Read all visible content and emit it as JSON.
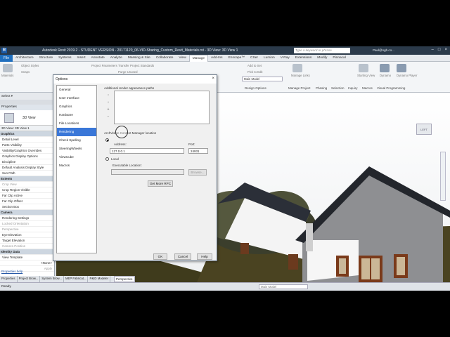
{
  "titlebar": {
    "app_title": "Autodesk Revit 2019.2 - STUDENT VERSION -   20171120_06-VID-Sharing_Custom_Revit_Materials.rvt - 3D View: 3D View 1",
    "search_placeholder": "Type a keyword or phrase",
    "user": "Paul@ngb.co..."
  },
  "tabs": [
    "File",
    "Architecture",
    "Structure",
    "Systems",
    "Insert",
    "Annotate",
    "Analyze",
    "Massing & Site",
    "Collaborate",
    "View",
    "Manage",
    "Add-Ins",
    "Enscape™",
    "CSer",
    "Lumion",
    "V-Ray",
    "Extensions",
    "Modify",
    "Pinnacal"
  ],
  "active_tab": "Manage",
  "ribbon": {
    "items": [
      "Materials",
      "Object Styles",
      "Snaps",
      "Project Parameters",
      "Transfer Project Standards",
      "Purge Unused",
      "Add to Set",
      "Pick to Edit",
      "Main Model",
      "Manage Links",
      "Starting View",
      "Dynamo",
      "Dynamo Player"
    ],
    "panels": [
      "Design Options",
      "Manage Project",
      "Phasing",
      "Selection",
      "Inquiry",
      "Macros",
      "Visual Programming"
    ]
  },
  "select_label": "Select ▾",
  "properties": {
    "header": "Properties",
    "type_name": "3D View",
    "selection": "3D View: 3D View 1",
    "rows": [
      {
        "label": "Graphics",
        "group": true
      },
      {
        "label": "Detail Level"
      },
      {
        "label": "Parts Visibility"
      },
      {
        "label": "Visibility/Graphics Overrides"
      },
      {
        "label": "Graphics Display Options"
      },
      {
        "label": "Discipline"
      },
      {
        "label": "Default Analysis Display Style"
      },
      {
        "label": "Sun Path"
      },
      {
        "label": "Extents",
        "group": true
      },
      {
        "label": "Crop View",
        "dim": true
      },
      {
        "label": "Crop Region Visible"
      },
      {
        "label": "Far Clip Active"
      },
      {
        "label": "Far Clip Offset"
      },
      {
        "label": "Section Box"
      },
      {
        "label": "Camera",
        "group": true
      },
      {
        "label": "Rendering Settings"
      },
      {
        "label": "Locked Orientation",
        "dim": true
      },
      {
        "label": "Perspective",
        "dim": true
      },
      {
        "label": "Eye Elevation"
      },
      {
        "label": "Target Elevation"
      },
      {
        "label": "Camera Position",
        "dim": true
      },
      {
        "label": "Identity Data",
        "group": true
      },
      {
        "label": "View Template"
      }
    ],
    "view_template_value": "<None>",
    "help_link": "Properties help",
    "apply": "Apply"
  },
  "bottom_tabs": [
    "Properties",
    "Project Brow...",
    "System Brow...",
    "MEP Fabricat...",
    "P&ID Modeler"
  ],
  "view_tab": "Perspective",
  "status": {
    "ready": "Ready",
    "main_model": "Main Model"
  },
  "viewport": {
    "viewcube_label": "LEFT"
  },
  "dialog": {
    "title": "Options",
    "nav": [
      "General",
      "User Interface",
      "Graphics",
      "Hardware",
      "File Locations",
      "Rendering",
      "Check Spelling",
      "SteeringWheels",
      "ViewCube",
      "Macros"
    ],
    "selected_nav": "Rendering",
    "paths_label": "Additional render appearance paths",
    "license_label": "ArchVision Content Manager location",
    "address_label": "Address:",
    "address_value": "127.0.0.1",
    "port_label": "Port:",
    "port_value": "24931",
    "local_label": "Local",
    "exec_label": "Executable Location:",
    "browse": "Browse...",
    "get_rpc": "Get More RPC",
    "ok": "OK",
    "cancel": "Cancel",
    "help": "Help"
  }
}
